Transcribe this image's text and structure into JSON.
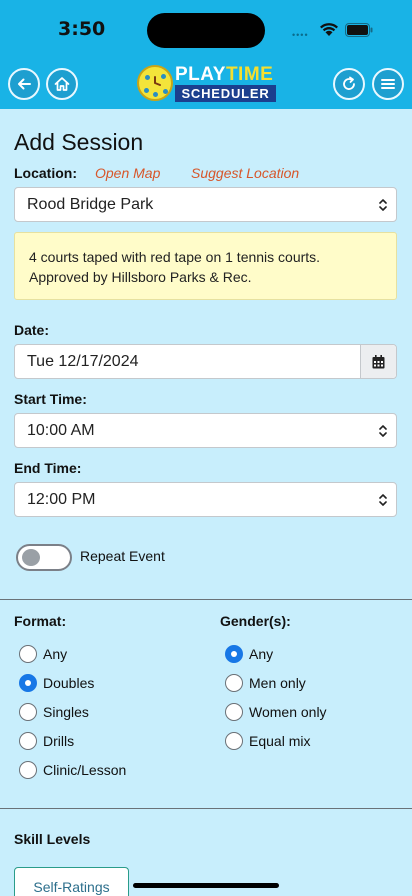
{
  "status": {
    "time": "3:50"
  },
  "header": {
    "logo_word1_a": "PLAY",
    "logo_word1_b": "TIME",
    "logo_word2": "SCHEDULER",
    "icons": [
      "back-icon",
      "home-icon",
      "refresh-icon",
      "menu-icon"
    ]
  },
  "form": {
    "title": "Add Session",
    "location_label": "Location:",
    "open_map": "Open Map",
    "suggest_location": "Suggest Location",
    "location_value": "Rood Bridge Park",
    "notice_line1": "4 courts taped with red tape on 1 tennis courts.",
    "notice_line2": "Approved by Hillsboro Parks & Rec.",
    "date_label": "Date:",
    "date_value": "Tue 12/17/2024",
    "start_label": "Start Time:",
    "start_value": "10:00 AM",
    "end_label": "End Time:",
    "end_value": "12:00 PM",
    "repeat_label": "Repeat Event",
    "repeat_on": false,
    "format_label": "Format:",
    "format_options": [
      "Any",
      "Doubles",
      "Singles",
      "Drills",
      "Clinic/Lesson"
    ],
    "format_selected": "Doubles",
    "gender_label": "Gender(s):",
    "gender_options": [
      "Any",
      "Men only",
      "Women only",
      "Equal mix"
    ],
    "gender_selected": "Any",
    "skill_label": "Skill Levels",
    "self_ratings_tab": "Self-Ratings"
  },
  "colors": {
    "header_bg": "#19b3e6",
    "page_bg": "#c8eefc",
    "link": "#d7562a",
    "notice_bg": "#fffcc9",
    "radio_selected": "#1777e6"
  }
}
